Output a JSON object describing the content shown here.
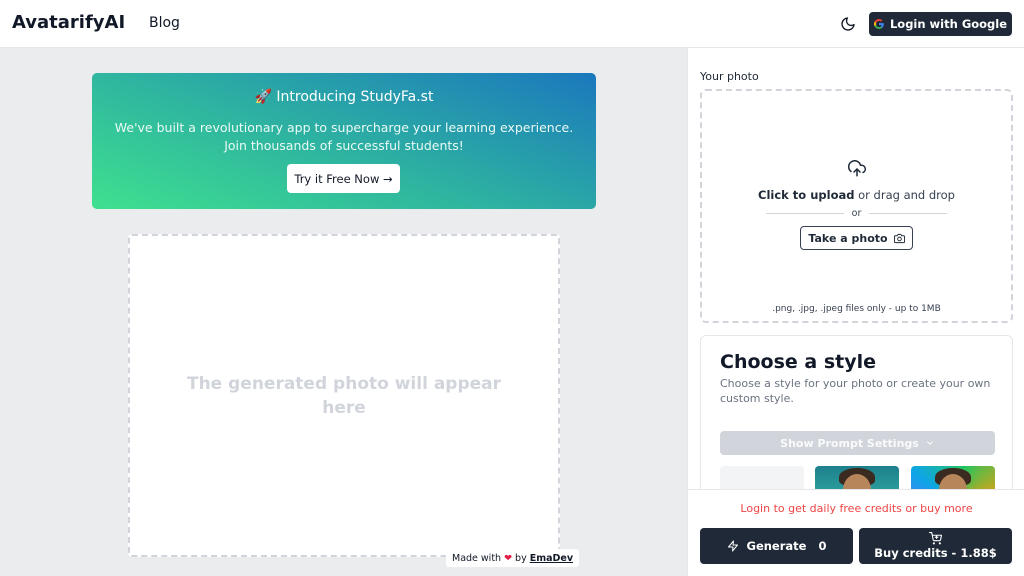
{
  "header": {
    "logo": "AvatarifyAI",
    "nav_blog": "Blog",
    "theme_icon": "moon-icon",
    "login_label": "Login with Google"
  },
  "banner": {
    "emoji": "🚀",
    "title": "Introducing StudyFa.st",
    "text_line1": "We've built a revolutionary app to supercharge your learning experience.",
    "text_line2": "Join thousands of successful students!",
    "button_label": "Try it Free Now →"
  },
  "result": {
    "placeholder": "The generated photo will appear here"
  },
  "footer": {
    "made_with": "Made with",
    "by": "by",
    "author": "EmaDev"
  },
  "upload": {
    "label": "Your photo",
    "click_upload": "Click to upload",
    "drag_drop": "or drag and drop",
    "or": "or",
    "take_photo": "Take a photo",
    "file_note": ".png, .jpg, .jpeg files only - up to 1MB"
  },
  "style": {
    "title": "Choose a style",
    "description": "Choose a style for your photo or create your own custom style.",
    "prompt_settings": "Show Prompt Settings"
  },
  "actions": {
    "login_credits": "Login to get daily free credits or buy more",
    "generate_label": "Generate",
    "generate_count": "0",
    "buy_label": "Buy credits - 1.88$"
  },
  "colors": {
    "dark": "#1f2937",
    "banner_start": "#3fe08f",
    "banner_end": "#1b78bd",
    "warning": "#ef4444"
  }
}
